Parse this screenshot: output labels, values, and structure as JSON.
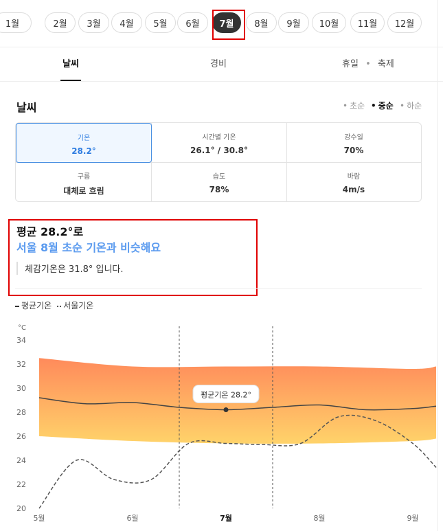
{
  "months": [
    "1월",
    "2월",
    "3월",
    "4월",
    "5월",
    "6월",
    "7월",
    "8월",
    "9월",
    "10월",
    "11월",
    "12월"
  ],
  "selected_month": "7월",
  "tabs": [
    "날씨",
    "경비",
    "휴일",
    "축제"
  ],
  "tab_sep": "•",
  "section_title": "날씨",
  "phases": [
    "초순",
    "중순",
    "하순"
  ],
  "selected_phase": "중순",
  "stats": [
    {
      "label": "기온",
      "value": "28.2°"
    },
    {
      "label": "시간별 기온",
      "value": "26.1° / 30.8°"
    },
    {
      "label": "강수일",
      "value": "70%"
    },
    {
      "label": "구름",
      "value": "대체로 흐림"
    },
    {
      "label": "습도",
      "value": "78%"
    },
    {
      "label": "바람",
      "value": "4m/s"
    }
  ],
  "summary": {
    "average": "평균 28.2°로",
    "compare": "서울 8월 초순 기온과 비슷해요",
    "feels_like": "체감기온은 31.8° 입니다."
  },
  "legend": {
    "avg": "평균기온",
    "seoul": "서울기온"
  },
  "colors": {
    "band_top": "#ff8a5b",
    "band_bottom": "#ffd36a",
    "avg_line": "#444444",
    "seoul_line": "#555555",
    "accent": "#5b9bef",
    "highlight": "#e00000"
  },
  "chart_data": {
    "type": "area",
    "yunit": "°C",
    "ylim": [
      20,
      34
    ],
    "yticks": [
      20,
      22,
      24,
      26,
      28,
      30,
      32,
      34
    ],
    "x_ticks": [
      "5월",
      "6월",
      "7월",
      "8월",
      "9월"
    ],
    "x_tick_positions": [
      0,
      1,
      2,
      3,
      4
    ],
    "xlim": [
      0,
      4.25
    ],
    "highlight_tick": "7월",
    "series": [
      {
        "name": "평균기온",
        "x": [
          0,
          0.5,
          1,
          1.5,
          2,
          2.5,
          3,
          3.5,
          4,
          4.25
        ],
        "values": [
          29.2,
          28.7,
          28.8,
          28.4,
          28.2,
          28.4,
          28.6,
          28.2,
          28.3,
          28.5
        ]
      },
      {
        "name": "서울기온",
        "x": [
          0,
          0.4,
          0.8,
          1.2,
          1.6,
          2.0,
          2.4,
          2.8,
          3.2,
          3.6,
          4.0,
          4.25
        ],
        "values": [
          20,
          24.0,
          22.4,
          22.4,
          25.4,
          25.4,
          25.3,
          25.4,
          27.6,
          27.3,
          25.4,
          23.4
        ]
      }
    ],
    "band_upper": {
      "x": [
        0,
        1,
        2,
        3,
        4,
        4.25
      ],
      "values": [
        32.5,
        31.8,
        31.8,
        31.8,
        31.6,
        31.8
      ]
    },
    "band_lower": {
      "x": [
        0,
        1,
        2,
        3,
        4,
        4.25
      ],
      "values": [
        26.0,
        25.6,
        25.4,
        25.4,
        25.6,
        25.8
      ]
    },
    "tooltip": {
      "label": "평균기온 28.2°",
      "x": 2,
      "y": 28.2
    },
    "dashed_markers_x": [
      1.5,
      2.5
    ],
    "grid": false
  }
}
